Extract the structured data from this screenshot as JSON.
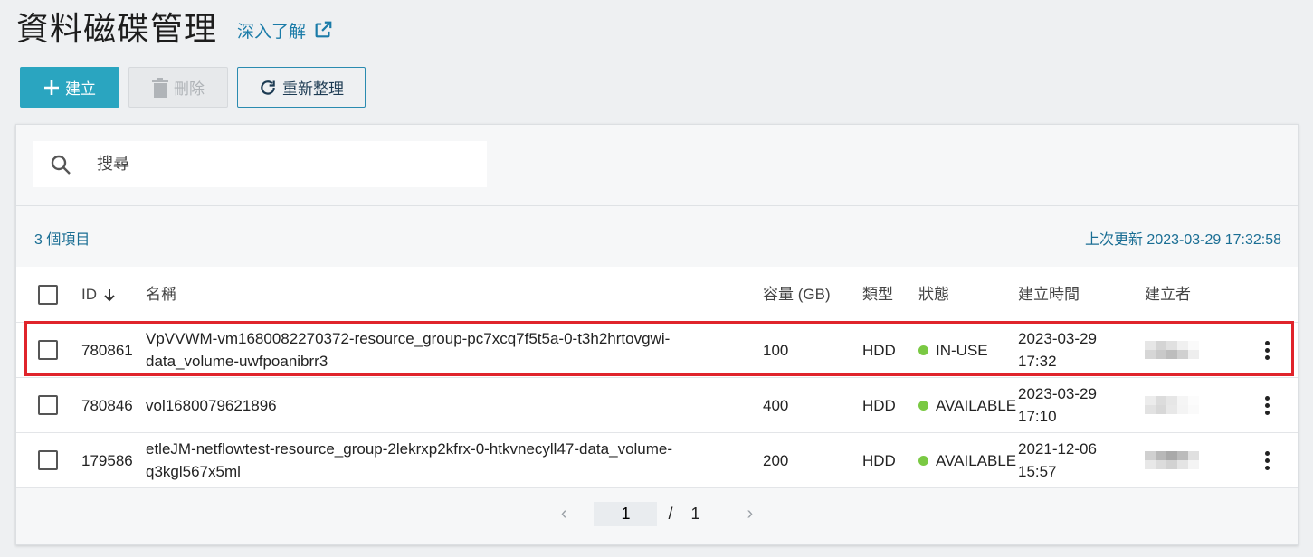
{
  "header": {
    "title": "資料磁碟管理",
    "learn_more": "深入了解"
  },
  "toolbar": {
    "create_label": "建立",
    "delete_label": "刪除",
    "refresh_label": "重新整理"
  },
  "search": {
    "placeholder": "搜尋"
  },
  "summary": {
    "count": "3 個項目",
    "last_updated": "上次更新 2023-03-29 17:32:58"
  },
  "table": {
    "columns": {
      "id": "ID",
      "name": "名稱",
      "size": "容量 (GB)",
      "type": "類型",
      "status": "狀態",
      "created": "建立時間",
      "creator": "建立者"
    },
    "sort_indicator": "arrow-down-icon",
    "rows": [
      {
        "id": "780861",
        "name": "VpVVWM-vm1680082270372-resource_group-pc7xcq7f5t5a-0-t3h2hrtovgwi-data_volume-uwfpoanibrr3",
        "size": "100",
        "type": "HDD",
        "status": "IN-USE",
        "created_date": "2023-03-29",
        "created_time": "17:32"
      },
      {
        "id": "780846",
        "name": "vol1680079621896",
        "size": "400",
        "type": "HDD",
        "status": "AVAILABLE",
        "created_date": "2023-03-29",
        "created_time": "17:10"
      },
      {
        "id": "179586",
        "name": "etleJM-netflowtest-resource_group-2lekrxp2kfrx-0-htkvnecyll47-data_volume-q3kgl567x5ml",
        "size": "200",
        "type": "HDD",
        "status": "AVAILABLE",
        "created_date": "2021-12-06",
        "created_time": "15:57"
      }
    ]
  },
  "pagination": {
    "current": "1",
    "separator": "/",
    "total": "1",
    "prev": "‹",
    "next": "›"
  },
  "colors": {
    "primary": "#2aa5c0",
    "link": "#1a7ba8",
    "status_green": "#7ac943",
    "highlight_red": "#e0242b"
  }
}
